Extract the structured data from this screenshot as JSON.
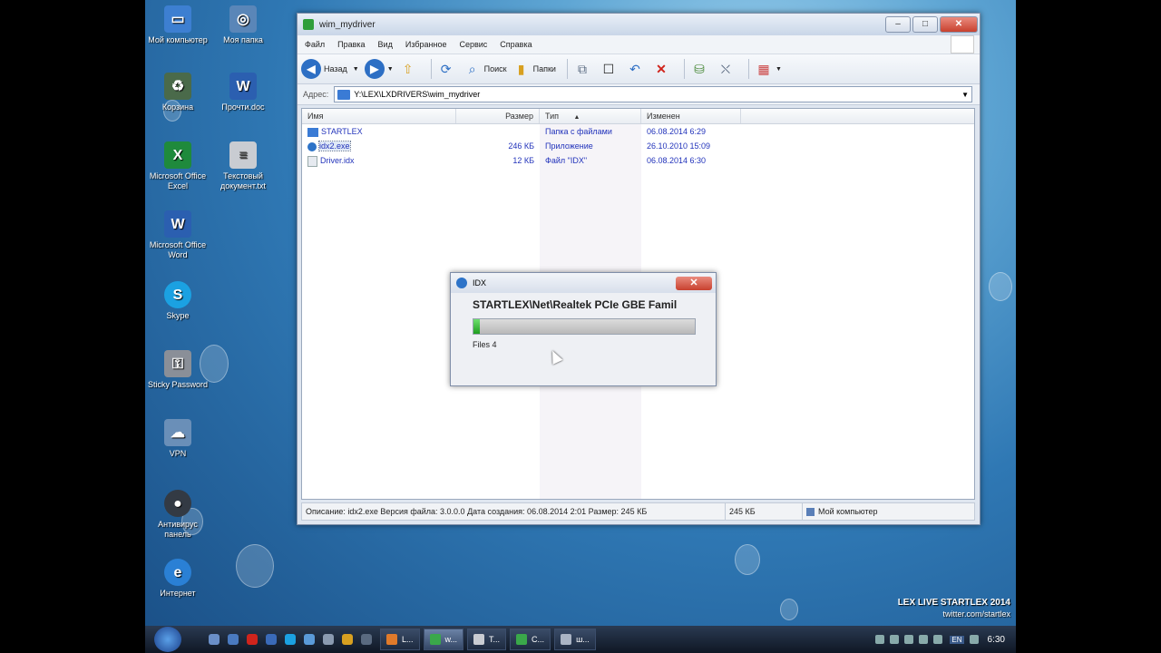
{
  "desktop": {
    "icons": [
      {
        "label": "Мой компьютер",
        "icon": "computer-icon",
        "color": "#3d7fd1"
      },
      {
        "label": "Моя папка",
        "icon": "folder-icon",
        "color": "#5a86b8"
      },
      {
        "label": "Корзина",
        "icon": "trash-icon",
        "color": "#4a6a4a"
      },
      {
        "label": "Прочти.doc",
        "icon": "word-doc-icon",
        "color": "#2b5fb0"
      },
      {
        "label": "Microsoft Office Excel",
        "icon": "excel-icon",
        "color": "#1f8a3c"
      },
      {
        "label": "Текстовый документ.txt",
        "icon": "text-file-icon",
        "color": "#c9ccd2"
      },
      {
        "label": "Microsoft Office Word",
        "icon": "word-icon",
        "color": "#2b5fb0"
      },
      {
        "label": "Skype",
        "icon": "skype-icon",
        "color": "#1ba1e2"
      },
      {
        "label": "Sticky Password",
        "icon": "sticky-password-icon",
        "color": "#8a8f98"
      },
      {
        "label": "VPN",
        "icon": "vpn-icon",
        "color": "#6a8fb8"
      },
      {
        "label": "Антивирус панель",
        "icon": "antivirus-icon",
        "color": "#333a44"
      },
      {
        "label": "Интернет",
        "icon": "internet-explorer-icon",
        "color": "#2a80d5"
      }
    ],
    "watermark": {
      "line1": "LEX LIVE STARTLEX 2014",
      "line2": "twitter.com/startlex"
    }
  },
  "window": {
    "title": "wim_mydriver",
    "minimize": "–",
    "maximize": "□",
    "close": "✕",
    "menu": [
      "Файл",
      "Правка",
      "Вид",
      "Избранное",
      "Сервис",
      "Справка"
    ],
    "toolbar": {
      "back": "Назад",
      "search": "Поиск",
      "folders": "Папки"
    },
    "address": {
      "label": "Адрес:",
      "value": "Y:\\LEX\\LXDRIVERS\\wim_mydriver"
    },
    "columns": {
      "name": "Имя",
      "size": "Размер",
      "type": "Тип",
      "modified": "Изменен"
    },
    "files": [
      {
        "name": "STARTLEX",
        "size": "",
        "type": "Папка с файлами",
        "modified": "06.08.2014 6:29",
        "icon_color": "#3a7bd5"
      },
      {
        "name": "idx2.exe",
        "size": "246 КБ",
        "type": "Приложение",
        "modified": "26.10.2010 15:09",
        "icon_color": "#2d73c8"
      },
      {
        "name": "Driver.idx",
        "size": "12 КБ",
        "type": "Файл \"IDX\"",
        "modified": "06.08.2014 6:30",
        "icon_color": "#e6eaf0"
      }
    ],
    "status": {
      "description": "Описание: idx2.exe Версия файла: 3.0.0.0 Дата создания: 06.08.2014 2:01 Размер: 245 КБ",
      "size": "245 КБ",
      "location": "Мой компьютер"
    }
  },
  "dialog": {
    "title": "IDX",
    "close": "✕",
    "path": "STARTLEX\\Net\\Realtek PCIe GBE Famil",
    "progress": 0.03,
    "files": "Files 4"
  },
  "taskbar": {
    "tasks": [
      {
        "label": "L...",
        "color": "#e07a2a"
      },
      {
        "label": "w...",
        "color": "#3aa84a",
        "active": true
      },
      {
        "label": "T...",
        "color": "#c9ccd2"
      },
      {
        "label": "C...",
        "color": "#3aa84a"
      },
      {
        "label": "ш...",
        "color": "#aab4c4"
      }
    ],
    "lang": "EN",
    "clock": "6:30"
  }
}
